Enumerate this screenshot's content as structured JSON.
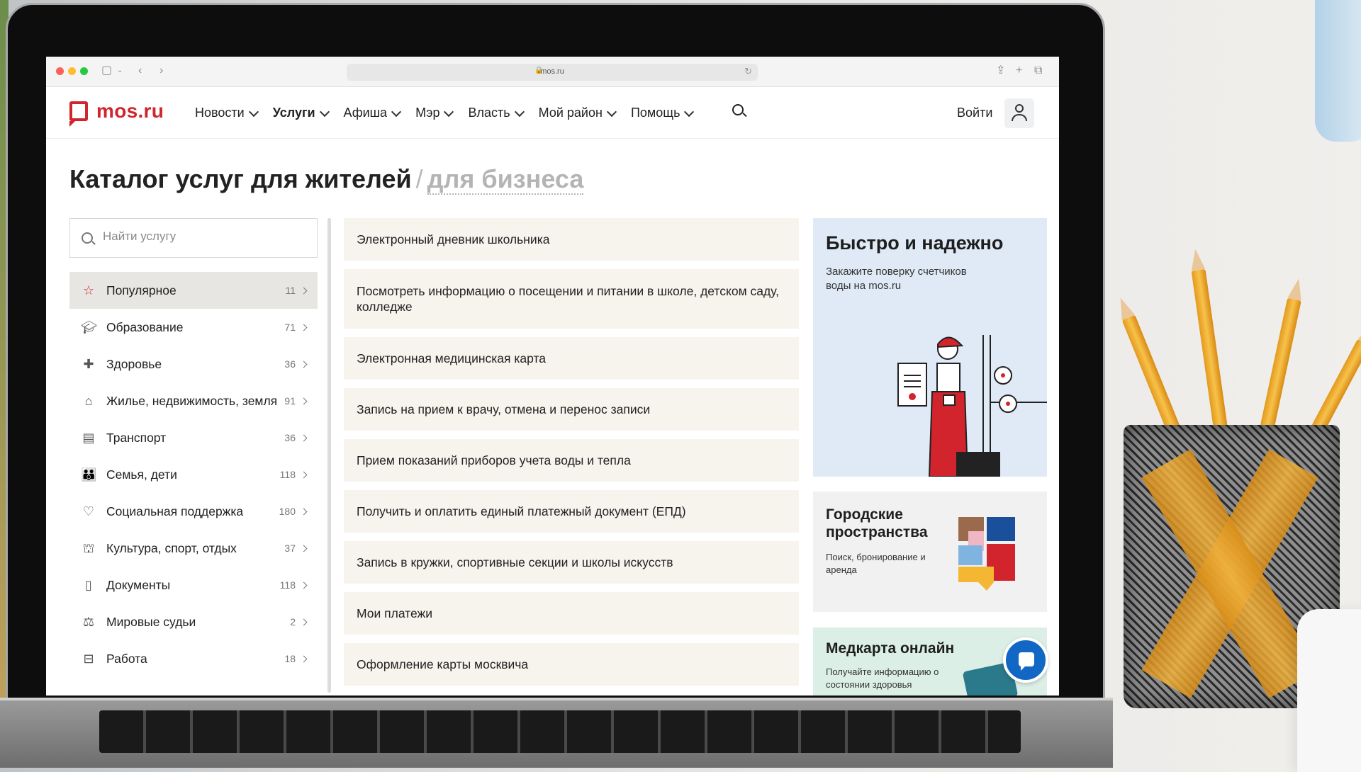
{
  "browser": {
    "url": "mos.ru"
  },
  "header": {
    "logo_text": "mos.ru",
    "nav": [
      {
        "label": "Новости"
      },
      {
        "label": "Услуги"
      },
      {
        "label": "Афиша"
      },
      {
        "label": "Мэр"
      },
      {
        "label": "Власть"
      },
      {
        "label": "Мой район"
      },
      {
        "label": "Помощь"
      }
    ],
    "login_label": "Войти"
  },
  "page": {
    "title": "Каталог услуг для жителей",
    "separator": "/",
    "alt_title": "для бизнеса"
  },
  "search": {
    "placeholder": "Найти услугу"
  },
  "categories": [
    {
      "icon": "star-icon",
      "label": "Популярное",
      "count": "11"
    },
    {
      "icon": "graduation-cap-icon",
      "label": "Образование",
      "count": "71"
    },
    {
      "icon": "medical-cross-icon",
      "label": "Здоровье",
      "count": "36"
    },
    {
      "icon": "house-icon",
      "label": "Жилье, недвижимость, земля",
      "count": "91"
    },
    {
      "icon": "bus-icon",
      "label": "Транспорт",
      "count": "36"
    },
    {
      "icon": "family-icon",
      "label": "Семья, дети",
      "count": "118"
    },
    {
      "icon": "heart-icon",
      "label": "Социальная поддержка",
      "count": "180"
    },
    {
      "icon": "theater-icon",
      "label": "Культура, спорт, отдых",
      "count": "37"
    },
    {
      "icon": "document-icon",
      "label": "Документы",
      "count": "118"
    },
    {
      "icon": "gavel-icon",
      "label": "Мировые судьи",
      "count": "2"
    },
    {
      "icon": "briefcase-icon",
      "label": "Работа",
      "count": "18"
    }
  ],
  "services": [
    {
      "label": "Электронный дневник школьника"
    },
    {
      "label": "Посмотреть информацию о посещении и питании в школе, детском саду, колледже"
    },
    {
      "label": "Электронная медицинская карта"
    },
    {
      "label": "Запись на прием к врачу, отмена и перенос записи"
    },
    {
      "label": "Прием показаний приборов учета воды и тепла"
    },
    {
      "label": "Получить и оплатить единый платежный документ (ЕПД)"
    },
    {
      "label": "Запись в кружки, спортивные секции и школы искусств"
    },
    {
      "label": "Мои платежи"
    },
    {
      "label": "Оформление карты москвича"
    }
  ],
  "promos": [
    {
      "title": "Быстро и надежно",
      "subtitle": "Закажите поверку счетчиков воды на mos.ru"
    },
    {
      "title": "Городские пространства",
      "subtitle": "Поиск, бронирование и аренда"
    },
    {
      "title": "Медкарта онлайн",
      "subtitle": "Получайте информацию о состоянии здоровья"
    }
  ],
  "colors": {
    "brand_red": "#d1242d",
    "chat_blue": "#1266c4",
    "service_bg": "#f7f4ee",
    "promo_blue": "#dfeaf6"
  }
}
